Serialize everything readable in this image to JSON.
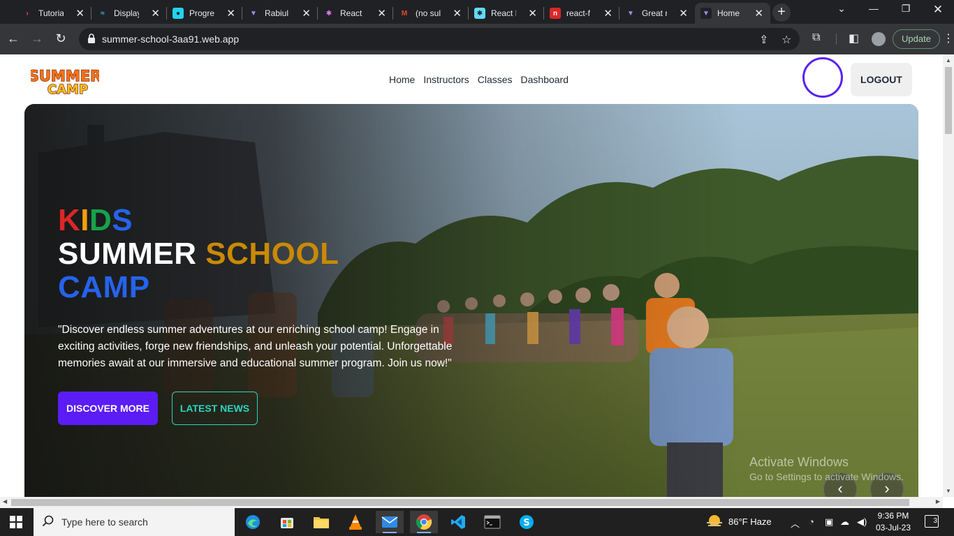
{
  "browser": {
    "tabs": [
      {
        "title": "Tutoria",
        "fav_bg": "#202124",
        "fav_fg": "#ff4d4d",
        "fav_glyph": "›"
      },
      {
        "title": "Display",
        "fav_bg": "#202124",
        "fav_fg": "#38bdf8",
        "fav_glyph": "≈"
      },
      {
        "title": "Progre",
        "fav_bg": "#22d3ee",
        "fav_fg": "#202124",
        "fav_glyph": "●"
      },
      {
        "title": "Rabiul",
        "fav_bg": "#202124",
        "fav_fg": "#a78bfa",
        "fav_glyph": "▼"
      },
      {
        "title": "React",
        "fav_bg": "#202124",
        "fav_fg": "#e879f9",
        "fav_glyph": "✱"
      },
      {
        "title": "(no sul",
        "fav_bg": "#202124",
        "fav_fg": "#ea4335",
        "fav_glyph": "M"
      },
      {
        "title": "React F",
        "fav_bg": "#61dafb",
        "fav_fg": "#202124",
        "fav_glyph": "✱"
      },
      {
        "title": "react-f",
        "fav_bg": "#dc2626",
        "fav_fg": "#ffffff",
        "fav_glyph": "n"
      },
      {
        "title": "Great r",
        "fav_bg": "#202124",
        "fav_fg": "#a78bfa",
        "fav_glyph": "▼"
      },
      {
        "title": "Home",
        "fav_bg": "#202124",
        "fav_fg": "#a78bfa",
        "fav_glyph": "▼"
      }
    ],
    "url": "summer-school-3aa91.web.app",
    "update_label": "Update"
  },
  "site": {
    "logo_line1": "SUMMER",
    "logo_line2": "CAMP",
    "nav": [
      "Home",
      "Instructors",
      "Classes",
      "Dashboard"
    ],
    "logout_label": "LOGOUT"
  },
  "hero": {
    "kids_letters": [
      {
        "ch": "K",
        "color": "#dc2626"
      },
      {
        "ch": "I",
        "color": "#f59e0b"
      },
      {
        "ch": "D",
        "color": "#16a34a"
      },
      {
        "ch": "S",
        "color": "#2563eb"
      }
    ],
    "line2_white": "SUMMER ",
    "line2_gold": "SCHOOL",
    "line3": "CAMP",
    "gold_color": "#ca8a04",
    "description": "\"Discover endless summer adventures at our enriching school camp! Engage in exciting activities, forge new friendships, and unleash your potential. Unforgettable memories await at our immersive and educational summer program. Join us now!\"",
    "discover_label": "DISCOVER MORE",
    "news_label": "LATEST NEWS",
    "prev_glyph": "‹",
    "next_glyph": "›"
  },
  "watermark": {
    "line1": "Activate Windows",
    "line2": "Go to Settings to activate Windows."
  },
  "taskbar": {
    "search_placeholder": "Type here to search",
    "weather": "86°F  Haze",
    "time": "9:36 PM",
    "date": "03-Jul-23",
    "notifications": "3"
  }
}
